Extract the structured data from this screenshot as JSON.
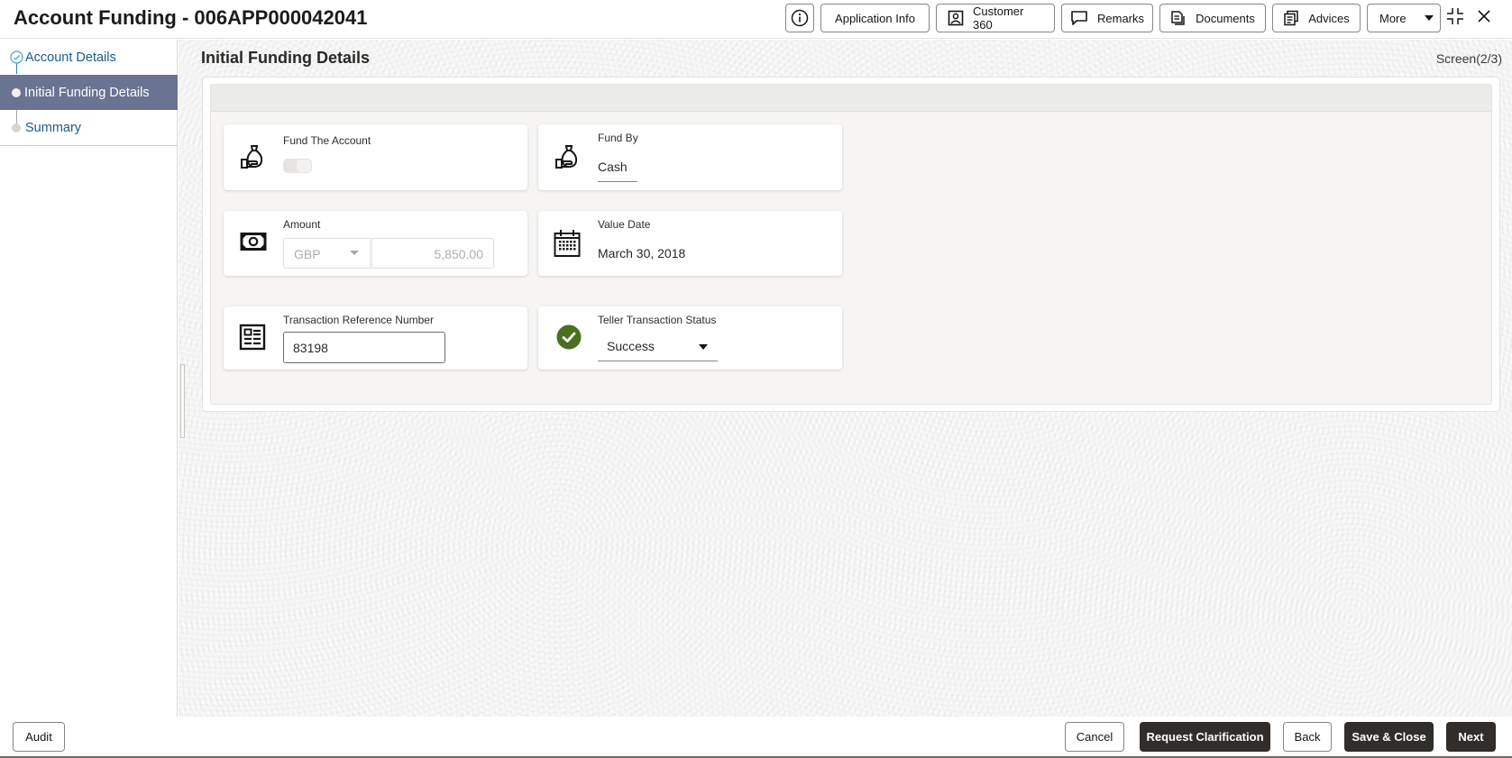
{
  "header": {
    "title": "Account Funding - 006APP000042041",
    "buttons": {
      "info": "info-icon",
      "application_info": "Application Info",
      "customer_360": "Customer 360",
      "remarks": "Remarks",
      "documents": "Documents",
      "advices": "Advices",
      "more": "More"
    }
  },
  "sidebar": {
    "items": [
      {
        "label": "Account Details",
        "state": "completed"
      },
      {
        "label": "Initial Funding Details",
        "state": "active"
      },
      {
        "label": "Summary",
        "state": "pending"
      }
    ]
  },
  "main": {
    "title": "Initial Funding Details",
    "screen_counter": "Screen(2/3)",
    "fields": {
      "fund_the_account": {
        "label": "Fund The Account",
        "value": false
      },
      "fund_by": {
        "label": "Fund By",
        "value": "Cash"
      },
      "amount": {
        "label": "Amount",
        "currency": "GBP",
        "value": "5,850.00"
      },
      "value_date": {
        "label": "Value Date",
        "value": "March 30, 2018"
      },
      "transaction_reference_number": {
        "label": "Transaction Reference Number",
        "value": "83198"
      },
      "teller_transaction_status": {
        "label": "Teller Transaction Status",
        "value": "Success"
      }
    }
  },
  "footer": {
    "audit": "Audit",
    "cancel": "Cancel",
    "request_clarification": "Request Clarification",
    "back": "Back",
    "save_close": "Save & Close",
    "next": "Next"
  },
  "colors": {
    "active_nav_bg": "#6b7393",
    "nav_link": "#1a5d84",
    "success_green": "#4a6f1f",
    "primary_button": "#312d2a"
  }
}
